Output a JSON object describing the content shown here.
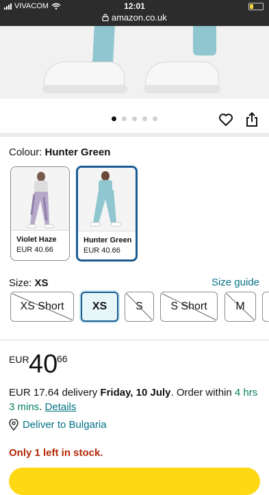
{
  "status_bar": {
    "carrier": "VIVACOM",
    "time": "12:01",
    "url": "amazon.co.uk"
  },
  "gallery": {
    "dot_count": 5,
    "active_dot": 0
  },
  "colour": {
    "label": "Colour:",
    "selected": "Hunter Green",
    "options": [
      {
        "name": "Violet Haze",
        "price": "EUR 40.66",
        "selected": false
      },
      {
        "name": "Hunter Green",
        "price": "EUR 40.66",
        "selected": true
      }
    ]
  },
  "size": {
    "label": "Size:",
    "selected": "XS",
    "guide": "Size guide",
    "options": [
      {
        "label": "XS Short",
        "available": false,
        "selected": false
      },
      {
        "label": "XS",
        "available": true,
        "selected": true
      },
      {
        "label": "S",
        "available": false,
        "selected": false
      },
      {
        "label": "S Short",
        "available": false,
        "selected": false
      },
      {
        "label": "M",
        "available": false,
        "selected": false
      }
    ]
  },
  "price": {
    "currency": "EUR",
    "whole": "40",
    "fraction": "66"
  },
  "delivery": {
    "fee": "EUR 17.64 delivery",
    "date": "Friday, 10 July",
    "order_within": ". Order within",
    "countdown": "4 hrs 3 mins",
    "details": "Details"
  },
  "deliver_to": "Deliver to Bulgaria",
  "stock": "Only 1 left in stock.",
  "colors": {
    "link": "#007185",
    "selected_border": "#1a5a92",
    "stock_red": "#b12704",
    "cart_yellow": "#ffd814"
  }
}
